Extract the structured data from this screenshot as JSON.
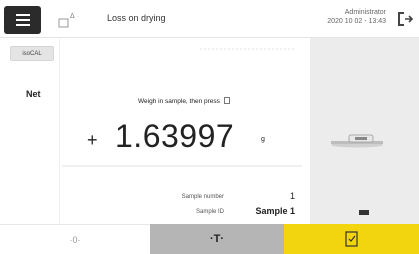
{
  "header": {
    "title": "Loss on drying",
    "user": "Administrator",
    "datetime": "2020 10 02 - 13:43",
    "menu_icon": "hamburger-menu-icon",
    "task_icon": "moisture-task-icon",
    "exit_icon": "logout-icon"
  },
  "left": {
    "isocal_label": "isoCAL",
    "net_label": "Net"
  },
  "main": {
    "instruction": "Weigh in sample, then press",
    "sign": "+",
    "weight": "1.63997",
    "unit": "g",
    "sample_number_label": "Sample number",
    "sample_number_value": "1",
    "sample_id_label": "Sample ID",
    "sample_id_value": "Sample 1"
  },
  "bottom": {
    "zero_label": "·0·",
    "tare_label": "·T·",
    "ok_icon": "confirm-document-icon"
  },
  "colors": {
    "accent_yellow": "#f2d40f",
    "tare_grey": "#b5b5b5",
    "menu_dark": "#2b2b2b"
  }
}
